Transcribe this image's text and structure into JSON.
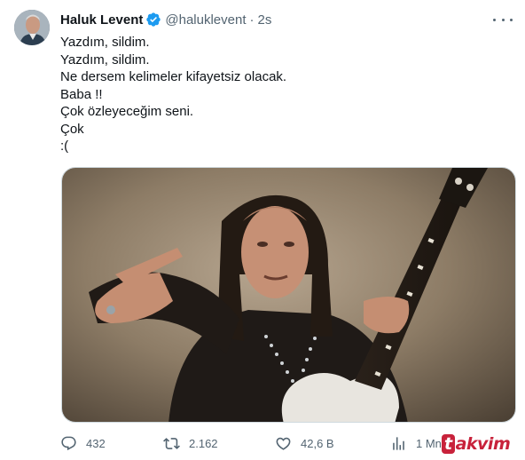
{
  "author": {
    "name": "Haluk Levent",
    "handle": "@haluklevent",
    "separator": "·",
    "time": "2s",
    "verified": true,
    "avatar_icon": "profile-photo"
  },
  "tweet": {
    "lines": [
      "Yazdım, sildim.",
      "Yazdım, sildim.",
      "Ne dersem kelimeler kifayetsiz olacak.",
      "Baba !!",
      "Çok özleyeceğim seni.",
      "Çok",
      ":("
    ]
  },
  "media": {
    "icon": "photo-man-pointing-with-guitar"
  },
  "actions": {
    "replies": "432",
    "retweets": "2.162",
    "likes": "42,6 B",
    "views": "1 Mn"
  },
  "icons": {
    "reply": "comment-icon",
    "retweet": "retweet-icon",
    "like": "heart-icon",
    "views": "chart-icon",
    "share": "share-icon",
    "more": "more-icon"
  },
  "colors": {
    "verified": "#1d9bf0",
    "text": "#0f1419",
    "secondary": "#536471",
    "watermark": "#c4102b"
  },
  "watermark": {
    "first": "t",
    "rest": "akvim"
  }
}
